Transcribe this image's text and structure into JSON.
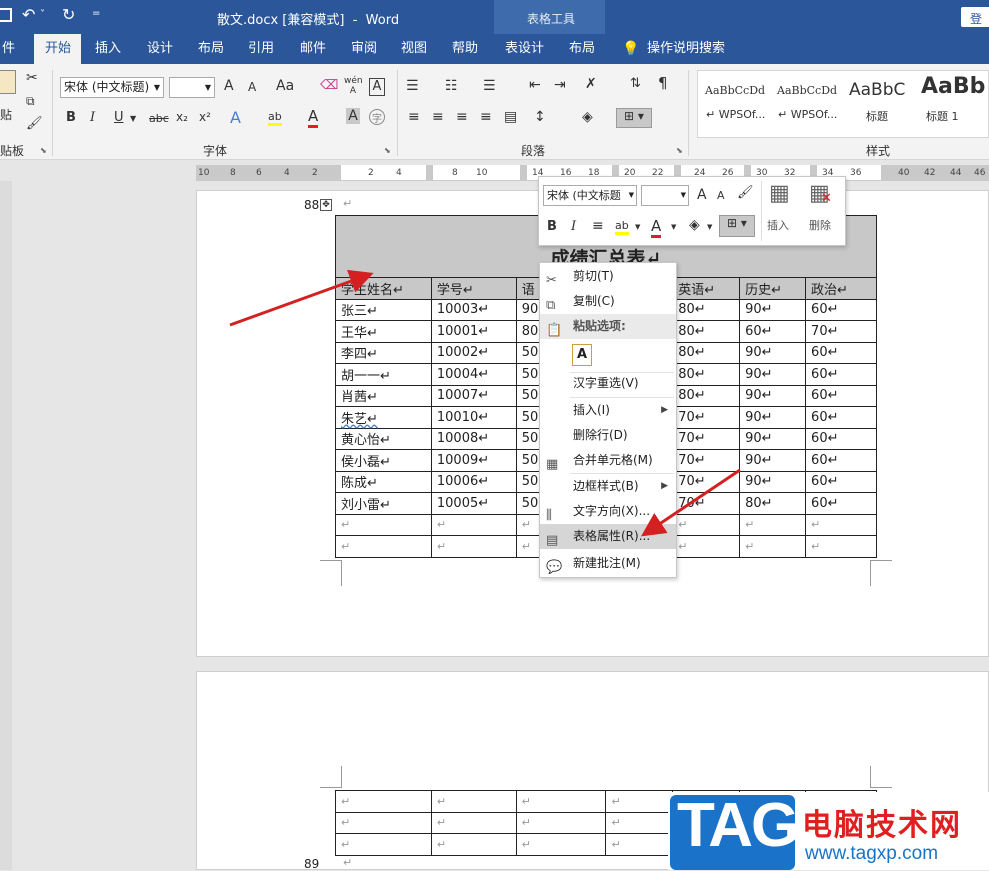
{
  "titlebar": {
    "save_icon": "save-icon",
    "undo_icon": "undo-icon",
    "redo_icon": "redo-icon",
    "quick_arrow": "˅",
    "qat_more": "=",
    "doc_title": "散文.docx [兼容模式]  -  Word",
    "contextual_group": "表格工具",
    "login": "登录"
  },
  "tabs": [
    "件",
    "开始",
    "插入",
    "设计",
    "布局",
    "引用",
    "邮件",
    "审阅",
    "视图",
    "帮助",
    "表设计",
    "布局"
  ],
  "tell_me": "操作说明搜索",
  "ribbon": {
    "clipboard_label": "贴板",
    "paste": "贴",
    "font_label": "字体",
    "paragraph_label": "段落",
    "styles_label": "样式",
    "font_name": "宋体 (中文标题)",
    "font_size": "",
    "bold": "B",
    "italic": "I",
    "underline": "U",
    "strike": "abc",
    "sub": "x₂",
    "sup": "x²",
    "grow": "A",
    "shrink": "A",
    "case": "Aa",
    "phonetic": "wén A",
    "border_char": "A",
    "effect": "A",
    "highlight": "ab",
    "font_color": "A",
    "shade": "A",
    "circle": "字",
    "styles": [
      {
        "preview": "AaBbCcDd",
        "name": "↵ WPSOf..."
      },
      {
        "preview": "AaBbCcDd",
        "name": "↵ WPSOf..."
      },
      {
        "preview": "AaBbC",
        "name": "标题"
      },
      {
        "preview": "AaBb",
        "name": "标题 1"
      }
    ]
  },
  "ruler": [
    "10",
    "8",
    "6",
    "4",
    "2",
    "2",
    "4",
    "8",
    "10",
    "14",
    "16",
    "18",
    "20",
    "22",
    "24",
    "26",
    "30",
    "32",
    "34",
    "36",
    "40",
    "42",
    "44",
    "46"
  ],
  "doc": {
    "page_num_1": "88",
    "page_num_2": "89",
    "para_mark": "↵",
    "table_title": "成绩汇总表↵",
    "headers": [
      "学生姓名↵",
      "学号↵",
      "语",
      "",
      "英语↵",
      "历史↵",
      "政治↵"
    ],
    "rows": [
      [
        "张三↵",
        "10003↵",
        "90",
        "",
        "80↵",
        "90↵",
        "60↵"
      ],
      [
        "王华↵",
        "10001↵",
        "80",
        "",
        "80↵",
        "60↵",
        "70↵"
      ],
      [
        "李四↵",
        "10002↵",
        "50",
        "",
        "80↵",
        "90↵",
        "60↵"
      ],
      [
        "胡一一↵",
        "10004↵",
        "50",
        "",
        "80↵",
        "90↵",
        "60↵"
      ],
      [
        "肖茜↵",
        "10007↵",
        "50",
        "",
        "80↵",
        "90↵",
        "60↵"
      ],
      [
        "朱艺↵",
        "10010↵",
        "50",
        "",
        "70↵",
        "90↵",
        "60↵"
      ],
      [
        "黄心怡↵",
        "10008↵",
        "50",
        "",
        "70↵",
        "90↵",
        "60↵"
      ],
      [
        "侯小磊↵",
        "10009↵",
        "50",
        "",
        "70↵",
        "90↵",
        "60↵"
      ],
      [
        "陈成↵",
        "10006↵",
        "50",
        "",
        "70↵",
        "90↵",
        "60↵"
      ],
      [
        "刘小雷↵",
        "10005↵",
        "50",
        "",
        "70↵",
        "80↵",
        "60↵"
      ],
      [
        "↵",
        "↵",
        "↵",
        "",
        "↵",
        "↵",
        "↵"
      ],
      [
        "↵",
        "↵",
        "↵",
        "",
        "↵",
        "↵",
        "↵"
      ]
    ],
    "page2_rows": [
      [
        "↵",
        "↵",
        "↵",
        "↵",
        "",
        "",
        ""
      ],
      [
        "↵",
        "↵",
        "↵",
        "↵",
        "",
        "",
        ""
      ],
      [
        "↵",
        "↵",
        "↵",
        "↵",
        "",
        "",
        ""
      ]
    ]
  },
  "minitoolbar": {
    "font": "宋体 (中文标题",
    "size": "",
    "grow": "A",
    "shrink": "A",
    "bold": "B",
    "italic": "I",
    "highlight": "ab",
    "font_color": "A",
    "insert": "插入",
    "delete": "删除"
  },
  "context_menu": [
    {
      "label": "剪切(T)",
      "icon": "scissors-icon"
    },
    {
      "label": "复制(C)",
      "icon": "copy-icon"
    },
    {
      "label": "粘贴选项:",
      "icon": "paste-icon"
    },
    {
      "label": "",
      "icon": "paste-keep-text-icon"
    },
    {
      "label": "汉字重选(V)",
      "icon": ""
    },
    {
      "label": "插入(I)",
      "icon": ""
    },
    {
      "label": "删除行(D)",
      "icon": ""
    },
    {
      "label": "合并单元格(M)",
      "icon": "merge-cells-icon"
    },
    {
      "label": "边框样式(B)",
      "icon": ""
    },
    {
      "label": "文字方向(X)...",
      "icon": "text-direction-icon"
    },
    {
      "label": "表格属性(R)...",
      "icon": "table-properties-icon"
    },
    {
      "label": "新建批注(M)",
      "icon": "comment-icon"
    }
  ],
  "watermark": {
    "tag": "TAG",
    "site": "电脑技术网",
    "url": "www.tagxp.com"
  },
  "colors": {
    "word_blue": "#2b579a",
    "arrow_red": "#d42020",
    "header_gray": "#c8c8c8",
    "tag_blue": "#1a73c8"
  }
}
